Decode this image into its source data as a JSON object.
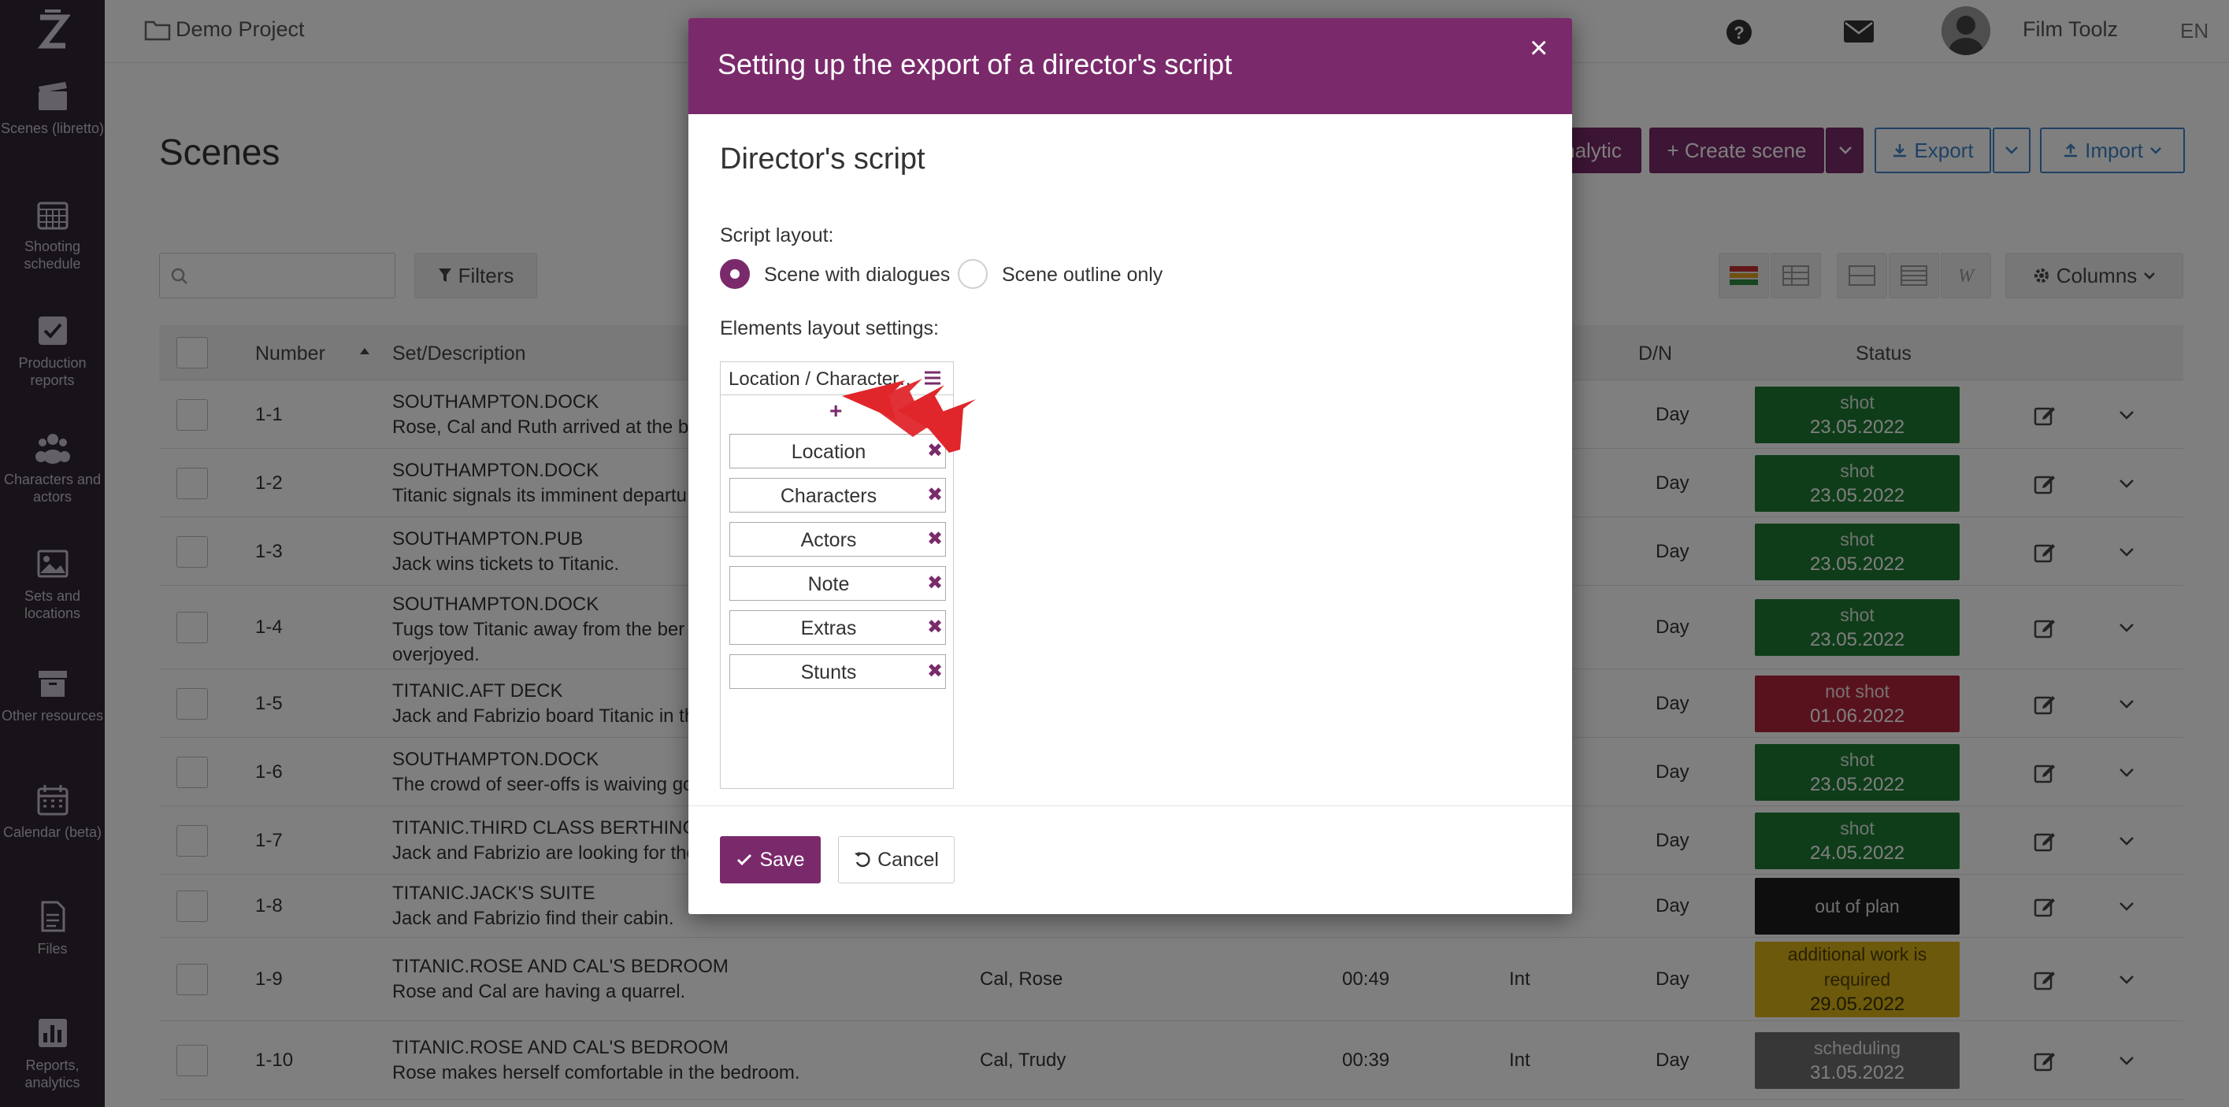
{
  "app": {
    "project": "Demo Project",
    "user_name": "Film Toolz",
    "language": "EN"
  },
  "sidebar": {
    "items": [
      {
        "label": "Scenes (libretto)",
        "icon": "clapperboard-icon"
      },
      {
        "label": "Shooting schedule",
        "icon": "calendar-grid-icon"
      },
      {
        "label": "Production reports",
        "icon": "checkbox-icon"
      },
      {
        "label": "Characters and actors",
        "icon": "people-icon"
      },
      {
        "label": "Sets and locations",
        "icon": "image-icon"
      },
      {
        "label": "Other resources",
        "icon": "archive-icon"
      },
      {
        "label": "Calendar (beta)",
        "icon": "calendar-icon"
      },
      {
        "label": "Files",
        "icon": "file-icon"
      },
      {
        "label": "Reports, analytics",
        "icon": "bar-chart-icon"
      }
    ]
  },
  "page": {
    "title": "Scenes",
    "analytic_label": "nalytic",
    "create_scene_label": "+ Create scene",
    "export_label": "Export",
    "import_label": "Import",
    "filters_label": "Filters",
    "columns_label": "Columns"
  },
  "table": {
    "headers": {
      "number": "Number",
      "set": "Set/Description",
      "dn": "D/N",
      "status": "Status"
    },
    "rows": [
      {
        "number": "1-1",
        "set": "SOUTHAMPTON.DOCK",
        "desc": "Rose, Cal and Ruth arrived at the be",
        "chars": "",
        "time": "",
        "ie": "",
        "dn": "Day",
        "status": "shot",
        "date": "23.05.2022",
        "color": "#1e7a32"
      },
      {
        "number": "1-2",
        "set": "SOUTHAMPTON.DOCK",
        "desc": "Titanic signals its imminent departu",
        "chars": "",
        "time": "",
        "ie": "",
        "dn": "Day",
        "status": "shot",
        "date": "23.05.2022",
        "color": "#1e7a32"
      },
      {
        "number": "1-3",
        "set": "SOUTHAMPTON.PUB",
        "desc": "Jack wins tickets to Titanic.",
        "chars": "",
        "time": "",
        "ie": "",
        "dn": "Day",
        "status": "shot",
        "date": "23.05.2022",
        "color": "#1e7a32"
      },
      {
        "number": "1-4",
        "set": "SOUTHAMPTON.DOCK",
        "desc": "Tugs tow Titanic away from the ber",
        "desc2": "overjoyed.",
        "chars": "",
        "time": "",
        "ie": "",
        "dn": "Day",
        "status": "shot",
        "date": "23.05.2022",
        "color": "#1e7a32"
      },
      {
        "number": "1-5",
        "set": "TITANIC.AFT DECK",
        "desc": "Jack and Fabrizio board Titanic in th",
        "chars": "",
        "time": "",
        "ie": "",
        "dn": "Day",
        "status": "not shot",
        "date": "01.06.2022",
        "color": "#b0253a"
      },
      {
        "number": "1-6",
        "set": "SOUTHAMPTON.DOCK",
        "desc": "The crowd of seer-offs is waiving go",
        "chars": "",
        "time": "",
        "ie": "",
        "dn": "Day",
        "status": "shot",
        "date": "23.05.2022",
        "color": "#1e7a32"
      },
      {
        "number": "1-7",
        "set": "TITANIC.THIRD CLASS BERTHING",
        "desc": "Jack and Fabrizio are looking for the",
        "chars": "",
        "time": "",
        "ie": "",
        "dn": "Day",
        "status": "shot",
        "date": "24.05.2022",
        "color": "#1e7a32"
      },
      {
        "number": "1-8",
        "set": "TITANIC.JACK'S SUITE",
        "desc": "Jack and Fabrizio find their cabin.",
        "chars": "",
        "time": "",
        "ie": "",
        "dn": "Day",
        "status": "out of plan",
        "date": "",
        "color": "#1c1c1c"
      },
      {
        "number": "1-9",
        "set": "TITANIC.ROSE AND CAL'S BEDROOM",
        "desc": "Rose and Cal are having a quarrel.",
        "chars": "Cal, Rose",
        "time": "00:49",
        "ie": "Int",
        "dn": "Day",
        "status": "additional work is required",
        "date": "29.05.2022",
        "color": "#d8b316"
      },
      {
        "number": "1-10",
        "set": "TITANIC.ROSE AND CAL'S BEDROOM",
        "desc": "Rose makes herself comfortable in the bedroom.",
        "chars": "Cal, Trudy",
        "time": "00:39",
        "ie": "Int",
        "dn": "Day",
        "status": "scheduling",
        "date": "31.05.2022",
        "color": "#6e6e6e"
      }
    ]
  },
  "modal": {
    "title": "Setting up the export of a director's script",
    "close": "×",
    "section_title": "Director's script",
    "script_layout_label": "Script layout:",
    "option_dialogues": "Scene with dialogues",
    "option_outline": "Scene outline only",
    "elements_label": "Elements layout settings:",
    "layout_header": "Location / Character…",
    "add_symbol": "+",
    "elements": [
      "Location",
      "Characters",
      "Actors",
      "Note",
      "Extras",
      "Stunts"
    ],
    "remove_symbol": "✖",
    "save_label": "Save",
    "cancel_label": "Cancel"
  },
  "colors": {
    "brand": "#7a2a6b",
    "sidebar_bg": "#2e2631",
    "status_shot": "#1e7a32",
    "status_not_shot": "#b0253a",
    "status_out_of_plan": "#1c1c1c",
    "status_additional": "#d8b316",
    "status_scheduling": "#6e6e6e",
    "pointer_arrow": "#e0262b"
  }
}
